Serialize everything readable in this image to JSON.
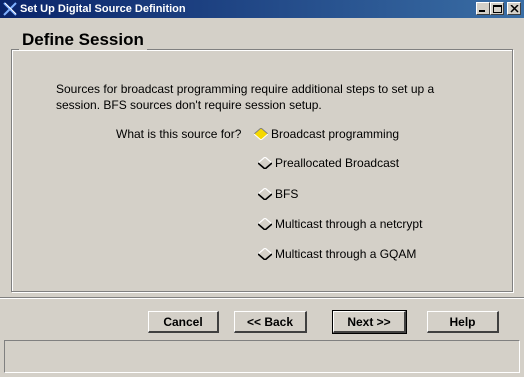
{
  "window": {
    "title": "Set Up Digital Source Definition",
    "controls": {
      "minimize": "_",
      "maximize": "□",
      "close": "X"
    }
  },
  "session": {
    "group_title": "Define Session",
    "intro_text": "Sources for broadcast programming require additional steps to set up a session.  BFS sources don't require session setup.",
    "question": "What is this source for?",
    "options": [
      {
        "label": "Broadcast programming",
        "selected": true
      },
      {
        "label": "Preallocated Broadcast",
        "selected": false
      },
      {
        "label": "BFS",
        "selected": false
      },
      {
        "label": "Multicast through a netcrypt",
        "selected": false
      },
      {
        "label": "Multicast through a GQAM",
        "selected": false
      }
    ]
  },
  "buttons": {
    "cancel": "Cancel",
    "back": "<< Back",
    "next": "Next >>",
    "help": "Help"
  },
  "status_bar": {
    "text": ""
  },
  "colors": {
    "background": "#d4d0c8",
    "title_start": "#0a246a",
    "title_end": "#3a6ea5",
    "selected_radio": "#f5d800"
  }
}
